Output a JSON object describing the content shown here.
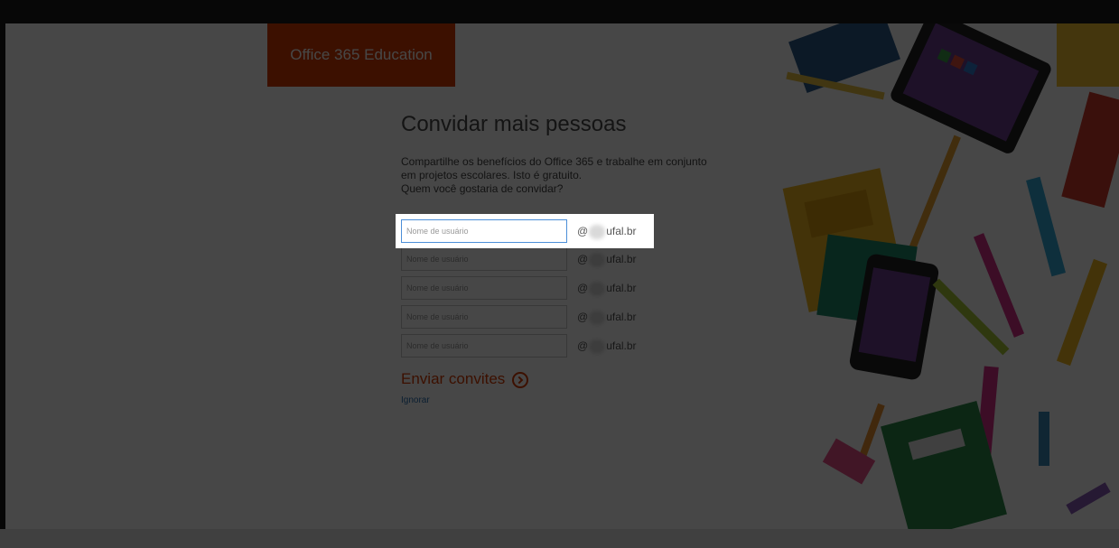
{
  "brand": {
    "tile_text": "Office 365 Education",
    "color": "#d83b01"
  },
  "invite": {
    "title": "Convidar mais pessoas",
    "description_lines": [
      "Compartilhe os benefícios do Office 365 e trabalhe em conjunto",
      "em projetos escolares. Isto é gratuito.",
      "Quem você gostaria de convidar?"
    ],
    "username_placeholder": "Nome de usuário",
    "rows": [
      {
        "value": "",
        "domain_prefix": "@",
        "domain_suffix": "ufal.br",
        "highlighted": true
      },
      {
        "value": "",
        "domain_prefix": "@",
        "domain_suffix": "ufal.br",
        "highlighted": false
      },
      {
        "value": "",
        "domain_prefix": "@",
        "domain_suffix": "ufal.br",
        "highlighted": false
      },
      {
        "value": "",
        "domain_prefix": "@",
        "domain_suffix": "ufal.br",
        "highlighted": false
      },
      {
        "value": "",
        "domain_prefix": "@",
        "domain_suffix": "ufal.br",
        "highlighted": false
      }
    ],
    "send_label": "Enviar convites",
    "send_icon": "arrow-circle-icon",
    "ignore_label": "Ignorar"
  },
  "overlay": {
    "dim_color": "rgba(0,0,0,0.72)"
  }
}
